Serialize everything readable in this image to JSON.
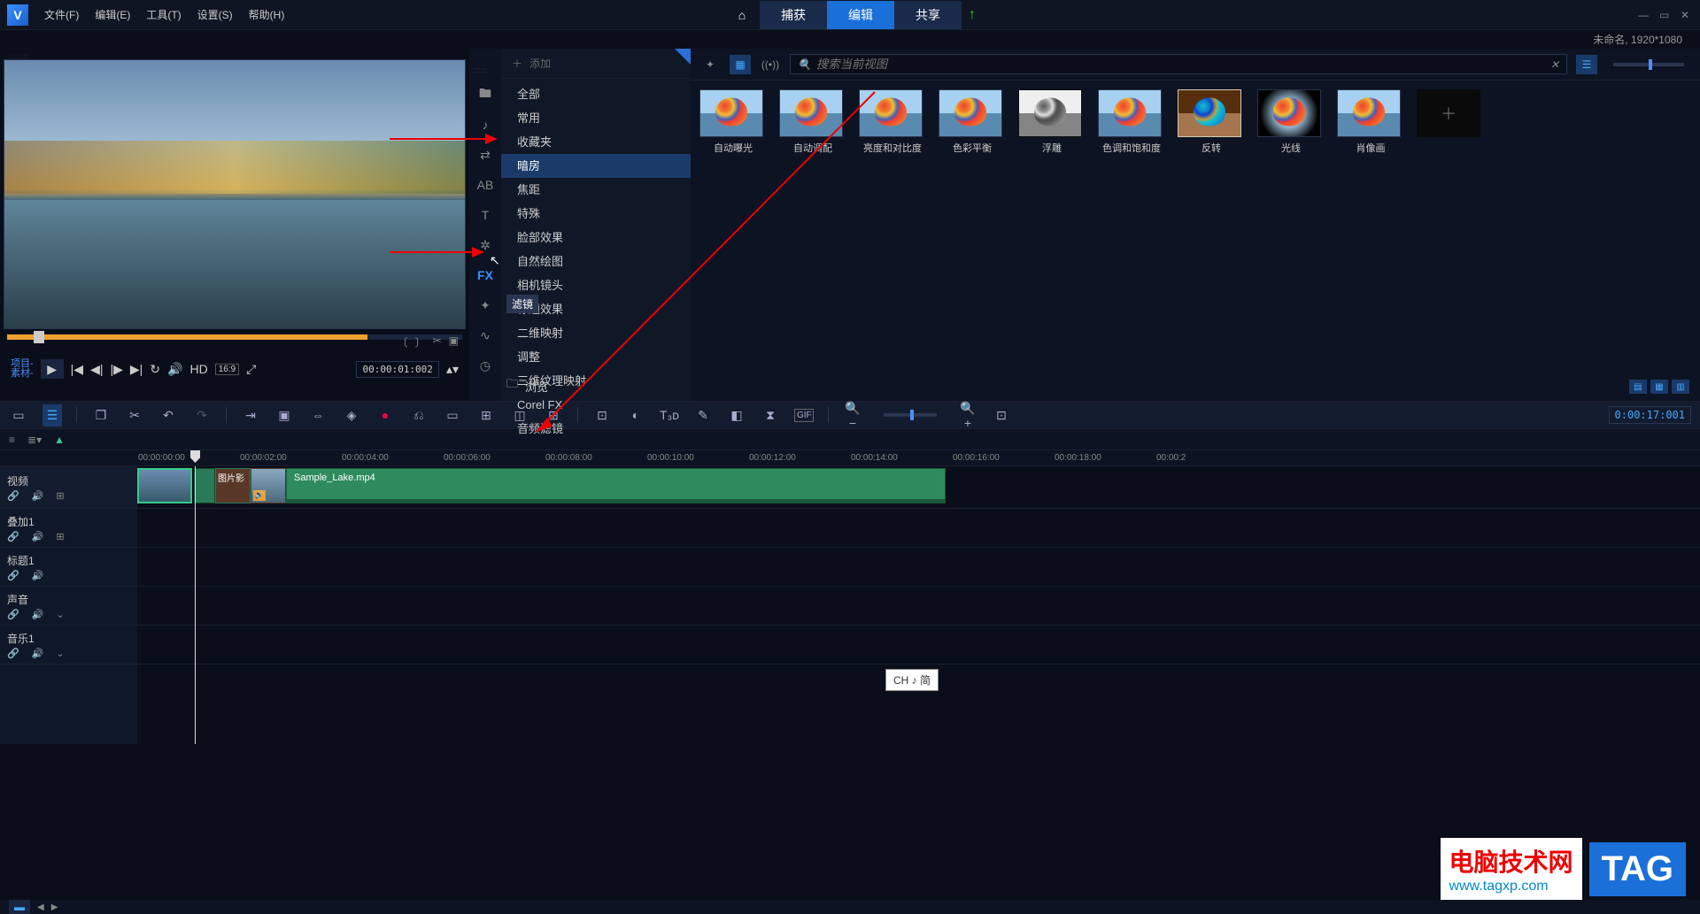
{
  "menu": {
    "file": "文件(F)",
    "edit": "编辑(E)",
    "tools": "工具(T)",
    "settings": "设置(S)",
    "help": "帮助(H)"
  },
  "main_tabs": {
    "capture": "捕获",
    "edit": "编辑",
    "share": "共享"
  },
  "project_info": "未命名, 1920*1080",
  "preview": {
    "mode_line1": "项目-",
    "mode_line2": "素材-",
    "hd": "HD",
    "ratio": "16:9",
    "timecode": "00:00:01:002"
  },
  "add_label": "添加",
  "categories": [
    "全部",
    "常用",
    "收藏夹",
    "暗房",
    "焦距",
    "特殊",
    "脸部效果",
    "自然绘图",
    "相机镜头",
    "标题效果",
    "二维映射",
    "调整",
    "三维纹理映射",
    "Corel FX",
    "音频滤镜"
  ],
  "selected_category_index": 3,
  "filter_tooltip": "滤镜",
  "browse": "浏览",
  "search_placeholder": "搜索当前视图",
  "thumbs": [
    {
      "label": "自动曝光"
    },
    {
      "label": "自动调配"
    },
    {
      "label": "亮度和对比度"
    },
    {
      "label": "色彩平衡"
    },
    {
      "label": "浮雕"
    },
    {
      "label": "色调和饱和度"
    },
    {
      "label": "反转"
    },
    {
      "label": "光线"
    },
    {
      "label": "肖像画"
    }
  ],
  "timeline": {
    "time_display": "0:00:17:001",
    "ruler": [
      "00:00:00:00",
      "00:00:02:00",
      "00:00:04:00",
      "00:00:06:00",
      "00:00:08:00",
      "00:00:10:00",
      "00:00:12:00",
      "00:00:14:00",
      "00:00:16:00",
      "00:00:18:00",
      "00:00:2"
    ],
    "tracks": {
      "video": "视频",
      "overlay": "叠加1",
      "title": "标题1",
      "voice": "声音",
      "music": "音乐1"
    },
    "clip_thumb_label": "图片影",
    "clip_main": "Sample_Lake.mp4"
  },
  "side_icons": [
    "folder",
    "note",
    "import",
    "ab",
    "text",
    "gear",
    "fx",
    "wand",
    "curve",
    "clock"
  ],
  "ime": "CH ♪ 简",
  "watermark": {
    "title": "电脑技术网",
    "url": "www.tagxp.com",
    "tag": "TAG"
  }
}
